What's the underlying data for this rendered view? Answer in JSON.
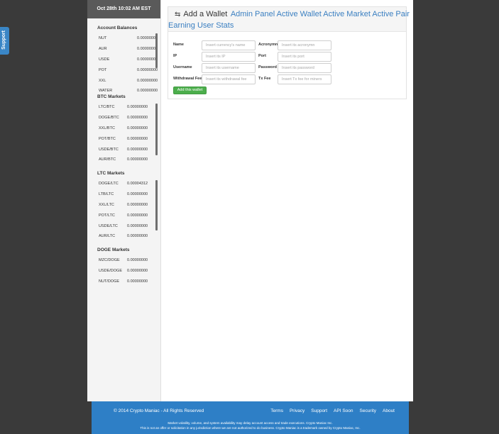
{
  "support_tab": {
    "label": "Support"
  },
  "sidebar": {
    "date": "Oct 28th 10:02 AM EST",
    "account_balances": {
      "title": "Account Balances",
      "rows": [
        {
          "name": "NUT",
          "value": "0.00000000"
        },
        {
          "name": "AUR",
          "value": "0.00000000"
        },
        {
          "name": "USDE",
          "value": "0.00000000"
        },
        {
          "name": "POT",
          "value": "0.00000000"
        },
        {
          "name": "XXL",
          "value": "0.00000000"
        },
        {
          "name": "WATER",
          "value": "0.00000000"
        }
      ]
    },
    "btc_markets": {
      "title": "BTC Markets",
      "rows": [
        {
          "name": "LTC/BTC",
          "value": "0.00000000"
        },
        {
          "name": "DOGE/BTC",
          "value": "0.00000000"
        },
        {
          "name": "XXL/BTC",
          "value": "0.00000000"
        },
        {
          "name": "POT/BTC",
          "value": "0.00000000"
        },
        {
          "name": "USDE/BTC",
          "value": "0.00000000"
        },
        {
          "name": "AUR/BTC",
          "value": "0.00000000"
        }
      ]
    },
    "ltc_markets": {
      "title": "LTC Markets",
      "rows": [
        {
          "name": "DOGE/LTC",
          "value": "0.00004312"
        },
        {
          "name": "LTB/LTC",
          "value": "0.00000000"
        },
        {
          "name": "XXL/LTC",
          "value": "0.00000000"
        },
        {
          "name": "POT/LTC",
          "value": "0.00000000"
        },
        {
          "name": "USDE/LTC",
          "value": "0.00000000"
        },
        {
          "name": "AUR/LTC",
          "value": "0.00000000"
        }
      ]
    },
    "doge_markets": {
      "title": "DOGE Markets",
      "rows": [
        {
          "name": "MZC/DOGE",
          "value": "0.00000000"
        },
        {
          "name": "USDE/DOGE",
          "value": "0.00000000"
        },
        {
          "name": "NUT/DOGE",
          "value": "0.00000000"
        }
      ]
    }
  },
  "panel": {
    "title": "Add a Wallet",
    "tabs": [
      "Admin Panel",
      "Active Wallet",
      "Active Market",
      "Active Pair",
      "Earning",
      "User Stats"
    ],
    "form": {
      "name": {
        "label": "Name",
        "placeholder": "Insert currency's name"
      },
      "acronym": {
        "label": "Acronymn",
        "placeholder": "Insert its acronymn"
      },
      "ip": {
        "label": "IP",
        "placeholder": "Insert its IP"
      },
      "port": {
        "label": "Port",
        "placeholder": "Insert its port"
      },
      "username": {
        "label": "Username",
        "placeholder": "Insert its username"
      },
      "password": {
        "label": "Password",
        "placeholder": "Insert its password"
      },
      "withdrawal_fee": {
        "label": "Withdrawal Fee",
        "placeholder": "Insert its withdrawal fee"
      },
      "tx_fee": {
        "label": "Tx Fee",
        "placeholder": "Insert Tx fee for miners"
      },
      "submit_label": "Add this wallet"
    }
  },
  "footer": {
    "copyright": "© 2014 Crypto Maniac - All Rights Reserved",
    "links": [
      "Terms",
      "Privacy",
      "Support",
      "API Soon",
      "Security",
      "About"
    ],
    "disclaimer_1": "Market volatility, volume, and system availability may delay account access and trade executions. Crypto Maniac Inc.",
    "disclaimer_2": "This is not an offer or solicitation in any jurisdiction where we are not authorized to do business. Crypto Maniac is a trademark owned by Crypto Maniac, Inc."
  }
}
